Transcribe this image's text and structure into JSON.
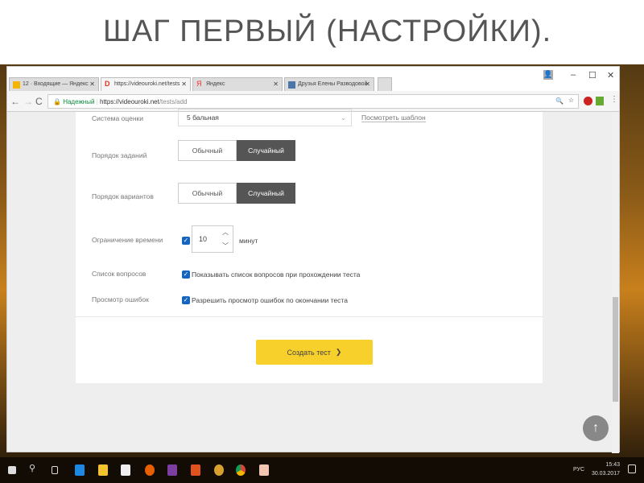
{
  "slide": {
    "title": "ШАГ ПЕРВЫЙ (НАСТРОЙКИ)."
  },
  "browser": {
    "tabs": [
      {
        "label": "12 · Входящие — Яндекс",
        "icon": "yandex-mail-icon"
      },
      {
        "label": "https://videouroki.net/tests",
        "icon": "videouroki-icon"
      },
      {
        "label": "Яндекс",
        "icon": "yandex-icon"
      },
      {
        "label": "Друзья Елены Разводовой",
        "icon": "vk-icon"
      }
    ],
    "secure_label": "Надежный",
    "url_host": "https://videouroki.net",
    "url_path": "/tests/add"
  },
  "form": {
    "grading_label": "Система оценки",
    "grading_value": "5 бальная",
    "view_template": "Посмотреть шаблон",
    "task_order_label": "Порядок заданий",
    "variant_order_label": "Порядок вариантов",
    "order_normal": "Обычный",
    "order_random": "Случайный",
    "time_limit_label": "Ограничение времени",
    "time_limit_value": "10",
    "minutes": "минут",
    "questions_list_label": "Список вопросов",
    "questions_list_option": "Показывать список вопросов при прохождении теста",
    "errors_label": "Просмотр ошибок",
    "errors_option": "Разрешить просмотр ошибок по окончании теста",
    "create_button": "Создать тест"
  },
  "taskbar": {
    "lang": "РУС",
    "time": "15:43",
    "date": "30.03.2017"
  }
}
